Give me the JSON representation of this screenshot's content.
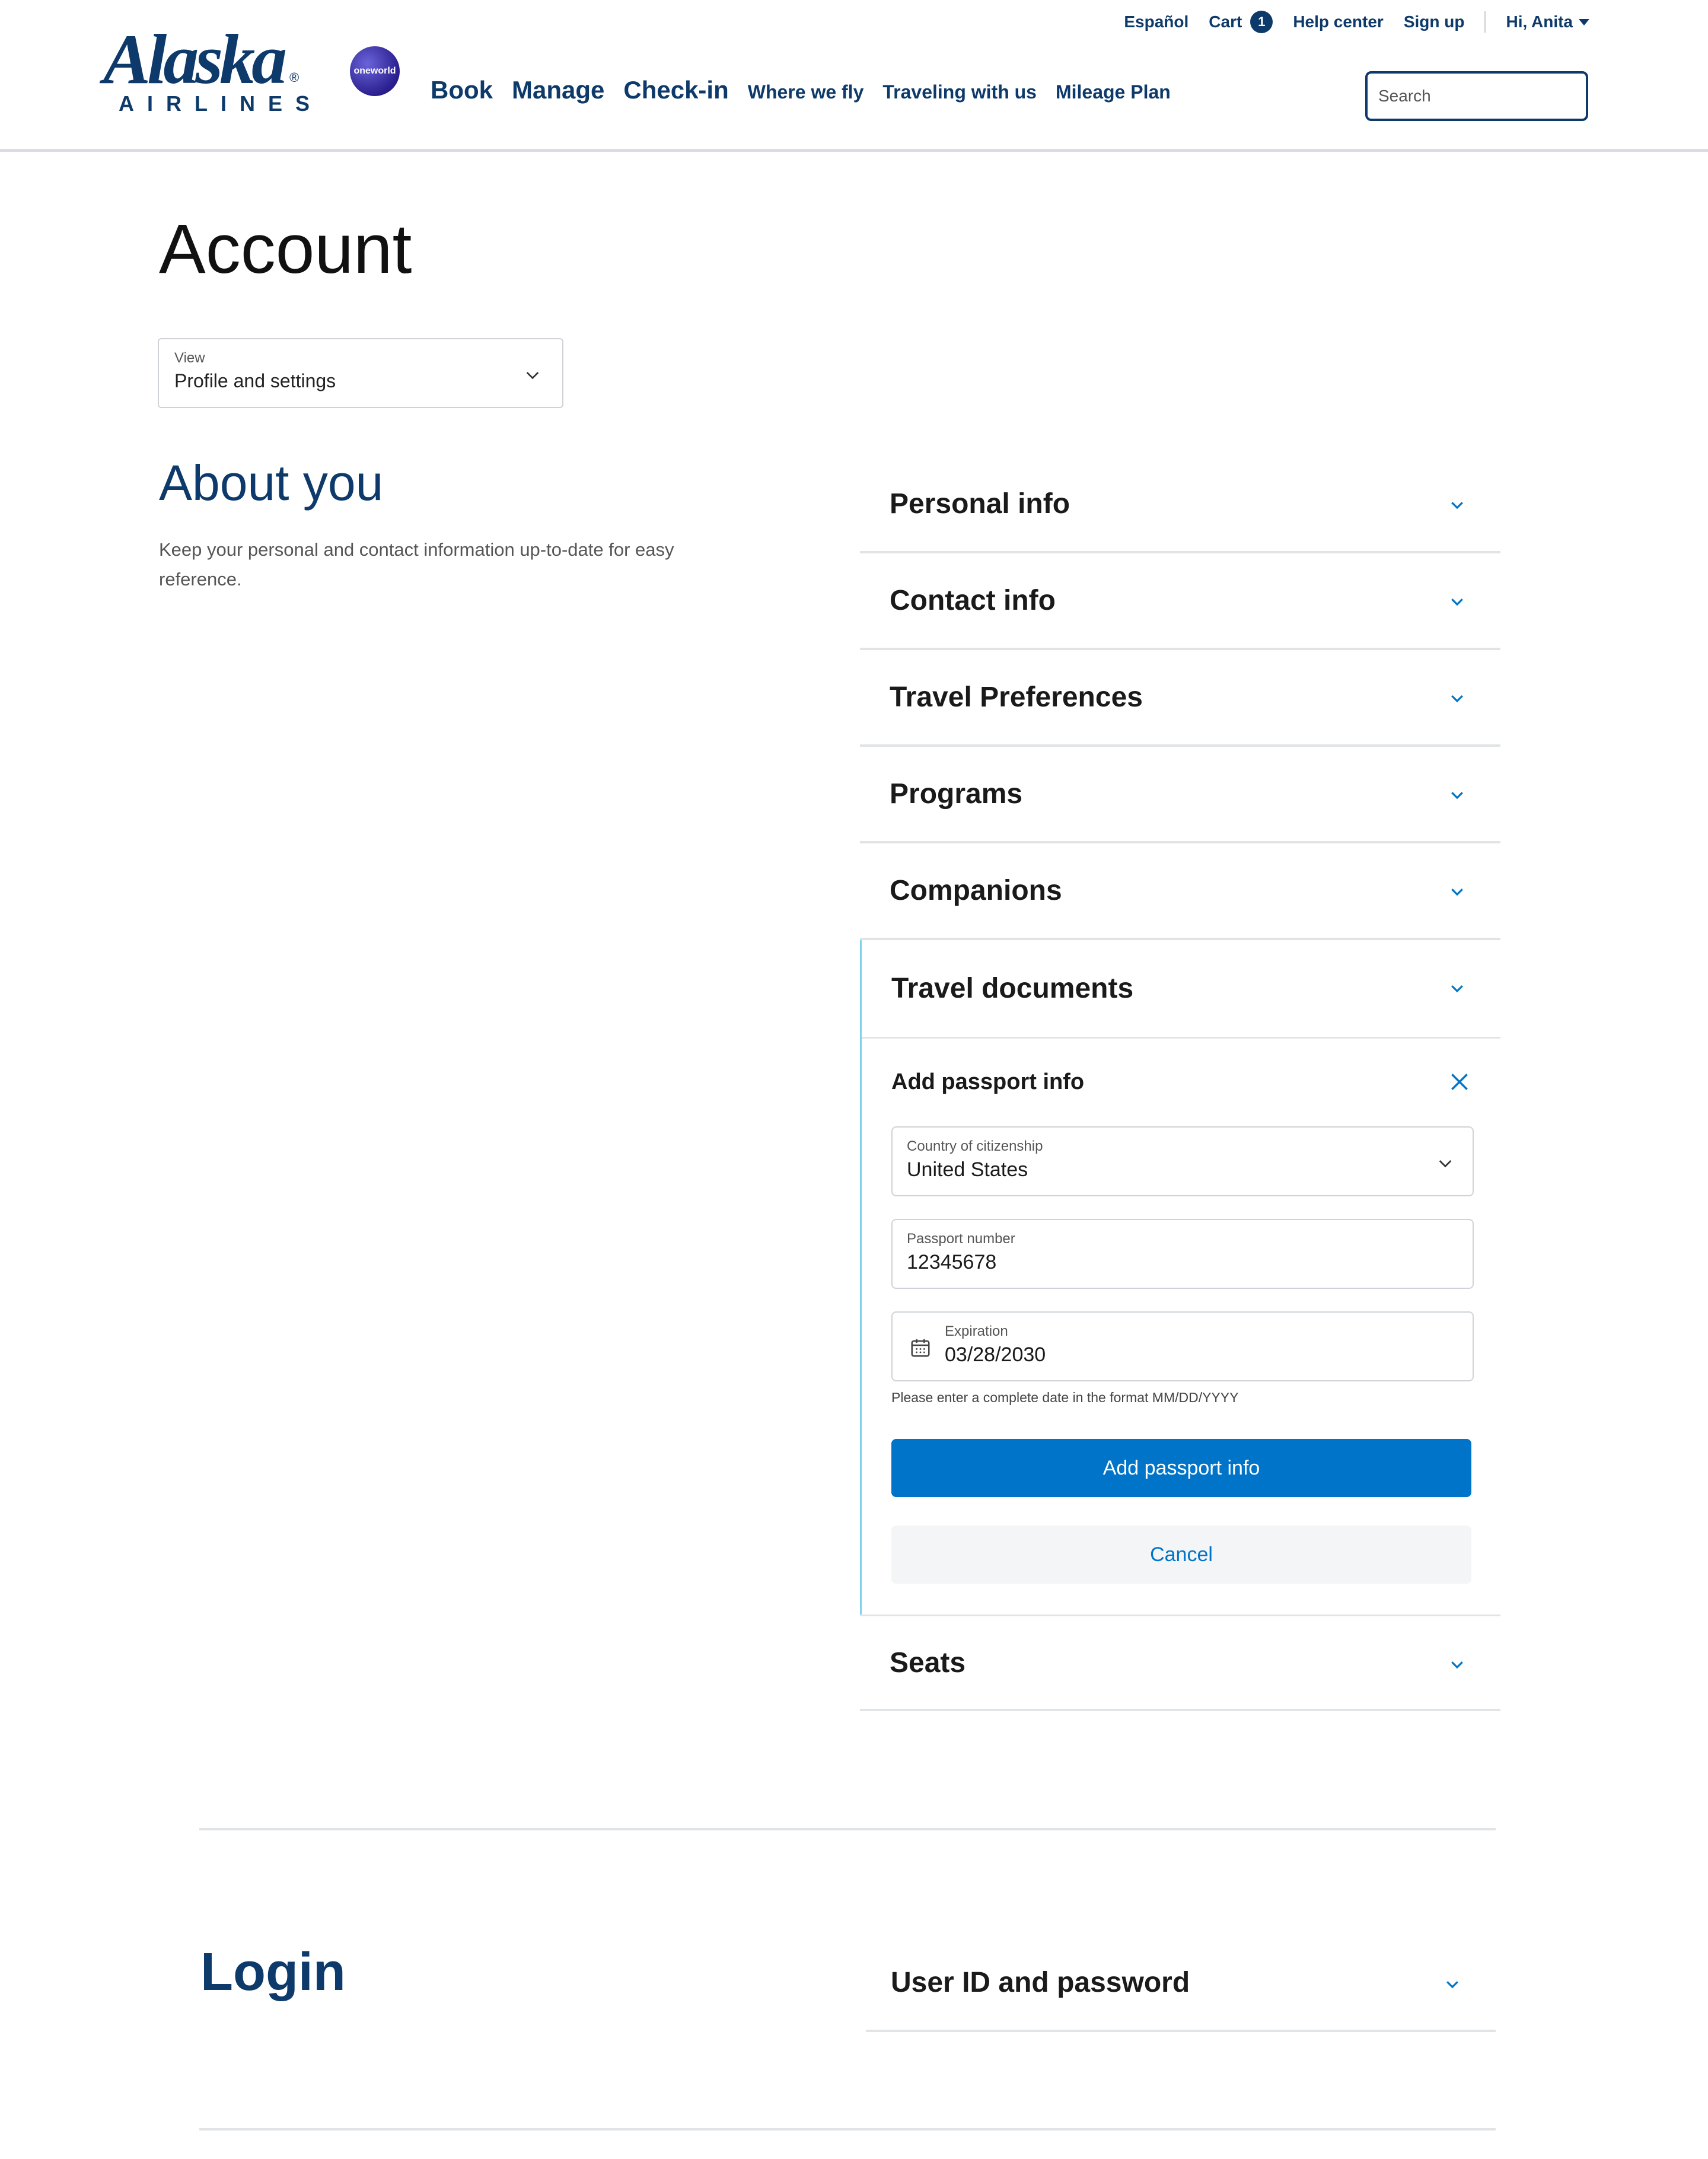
{
  "brand": {
    "logo_word": "Alaska",
    "logo_sub": "AIRLINES",
    "logo_reg": "®",
    "partner": "oneworld"
  },
  "utility_nav": {
    "language": "Español",
    "cart_label": "Cart",
    "cart_count": "1",
    "help": "Help center",
    "signup": "Sign up",
    "greeting": "Hi, Anita"
  },
  "main_nav": {
    "book": "Book",
    "manage": "Manage",
    "checkin": "Check-in",
    "where": "Where we fly",
    "traveling": "Traveling with us",
    "mileage": "Mileage Plan"
  },
  "search": {
    "placeholder": "Search"
  },
  "page": {
    "title": "Account"
  },
  "view_select": {
    "label": "View",
    "value": "Profile and settings"
  },
  "about": {
    "title": "About you",
    "description": "Keep your personal and contact information up-to-date for easy reference."
  },
  "sections": [
    {
      "label": "Personal info"
    },
    {
      "label": "Contact info"
    },
    {
      "label": "Travel Preferences"
    },
    {
      "label": "Programs"
    },
    {
      "label": "Companions"
    },
    {
      "label": "Travel documents"
    },
    {
      "label": "Seats"
    }
  ],
  "passport_form": {
    "heading": "Add passport info",
    "country": {
      "label": "Country of citizenship",
      "value": "United States"
    },
    "number": {
      "label": "Passport number",
      "value": "12345678"
    },
    "expiration": {
      "label": "Expiration",
      "value": "03/28/2030"
    },
    "hint": "Please enter a complete date in the format MM/DD/YYYY",
    "submit": "Add passport info",
    "cancel": "Cancel"
  },
  "login": {
    "title": "Login",
    "section": "User ID and password"
  },
  "colors": {
    "navy": "#0d3a6a",
    "primary_button": "#0074c8",
    "open_accent": "#7fd3e8"
  }
}
